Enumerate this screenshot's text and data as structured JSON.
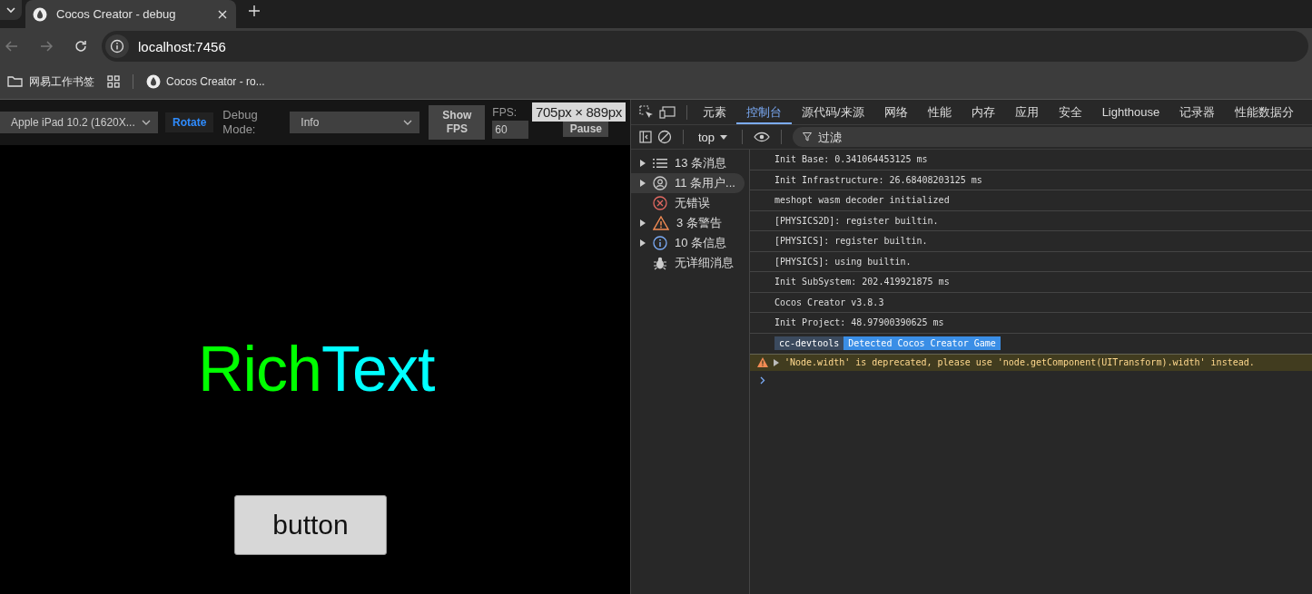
{
  "browser": {
    "tabs": [
      {
        "title": "Cocos Creator - debug",
        "selected": true
      }
    ],
    "address": "localhost:7456",
    "bookmarks": [
      {
        "kind": "folder",
        "label": "网易工作书签"
      },
      {
        "kind": "apps"
      },
      {
        "kind": "page",
        "label": "Cocos Creator - ro..."
      }
    ]
  },
  "game_toolbar": {
    "device": "Apple iPad 10.2 (1620X...",
    "rotate": "Rotate",
    "debug_mode_label": "Debug Mode:",
    "debug_mode": "Info",
    "show_fps": "Show FPS",
    "fps_label": "FPS:",
    "fps_value": "60",
    "pause": "Pause",
    "size_tooltip": "705px × 889px"
  },
  "game_canvas": {
    "rich_text": [
      {
        "text": "Rich",
        "color": "#00ff00"
      },
      {
        "text": "Text",
        "color": "#00ffff"
      }
    ],
    "button": "button"
  },
  "devtools": {
    "tabs": [
      {
        "label": "元素",
        "selected": false
      },
      {
        "label": "控制台",
        "selected": true
      },
      {
        "label": "源代码/来源",
        "selected": false
      },
      {
        "label": "网络",
        "selected": false
      },
      {
        "label": "性能",
        "selected": false
      },
      {
        "label": "内存",
        "selected": false
      },
      {
        "label": "应用",
        "selected": false
      },
      {
        "label": "安全",
        "selected": false
      },
      {
        "label": "Lighthouse",
        "selected": false
      },
      {
        "label": "记录器",
        "selected": false
      },
      {
        "label": "性能数据分",
        "selected": false
      }
    ],
    "context": "top",
    "filter_placeholder": "过滤",
    "sidebar": [
      {
        "kind": "messages",
        "label": "13 条消息",
        "expandable": true,
        "selected": false
      },
      {
        "kind": "user",
        "label": "11 条用户...",
        "expandable": true,
        "selected": true
      },
      {
        "kind": "errors",
        "label": "无错误",
        "expandable": false,
        "selected": false
      },
      {
        "kind": "warnings",
        "label": "3 条警告",
        "expandable": true,
        "selected": false
      },
      {
        "kind": "info",
        "label": "10 条信息",
        "expandable": true,
        "selected": false
      },
      {
        "kind": "verbose",
        "label": "无详细消息",
        "expandable": false,
        "selected": false
      }
    ],
    "log": [
      {
        "kind": "log",
        "text": "Init Base: 0.341064453125 ms"
      },
      {
        "kind": "log",
        "text": "Init Infrastructure: 26.68408203125 ms"
      },
      {
        "kind": "log",
        "text": "meshopt wasm decoder initialized"
      },
      {
        "kind": "log",
        "text": "[PHYSICS2D]: register builtin."
      },
      {
        "kind": "log",
        "text": "[PHYSICS]: register builtin."
      },
      {
        "kind": "log",
        "text": "[PHYSICS]: using builtin."
      },
      {
        "kind": "log",
        "text": "Init SubSystem: 202.419921875 ms"
      },
      {
        "kind": "log",
        "text": "Cocos Creator v3.8.3"
      },
      {
        "kind": "log",
        "text": "Init Project: 48.97900390625 ms"
      },
      {
        "kind": "badge",
        "parts": [
          "cc-devtools",
          "Detected Cocos Creator Game"
        ]
      },
      {
        "kind": "warning",
        "text": "'Node.width' is deprecated, please use 'node.getComponent(UITransform).width' instead."
      }
    ]
  }
}
